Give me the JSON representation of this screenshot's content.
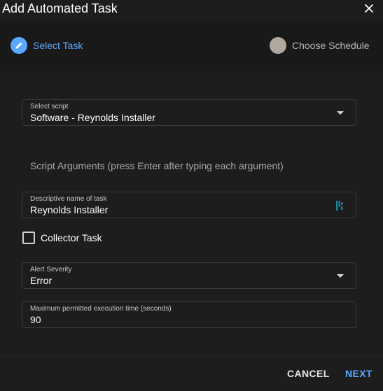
{
  "dialog": {
    "title": "Add Automated Task"
  },
  "stepper": {
    "steps": [
      {
        "label": "Select Task",
        "state": "active"
      },
      {
        "label": "Choose Schedule",
        "state": "inactive"
      }
    ]
  },
  "form": {
    "script": {
      "label": "Select script",
      "value": "Software - Reynolds Installer"
    },
    "script_arguments": {
      "label": "Script Arguments (press Enter after typing each argument)"
    },
    "task_name": {
      "label": "Descriptive name of task",
      "value": "Reynolds Installer"
    },
    "collector_task": {
      "label": "Collector Task",
      "checked": false
    },
    "alert_severity": {
      "label": "Alert Severity",
      "value": "Error"
    },
    "max_execution_time": {
      "label": "Maximum permitted execution time (seconds)",
      "value": "90"
    }
  },
  "footer": {
    "cancel_label": "CANCEL",
    "next_label": "NEXT"
  },
  "colors": {
    "accent": "#5aa8ff",
    "background": "#1d1d1d",
    "stepper_background": "#191919",
    "inactive_step": "#b0a89f"
  }
}
